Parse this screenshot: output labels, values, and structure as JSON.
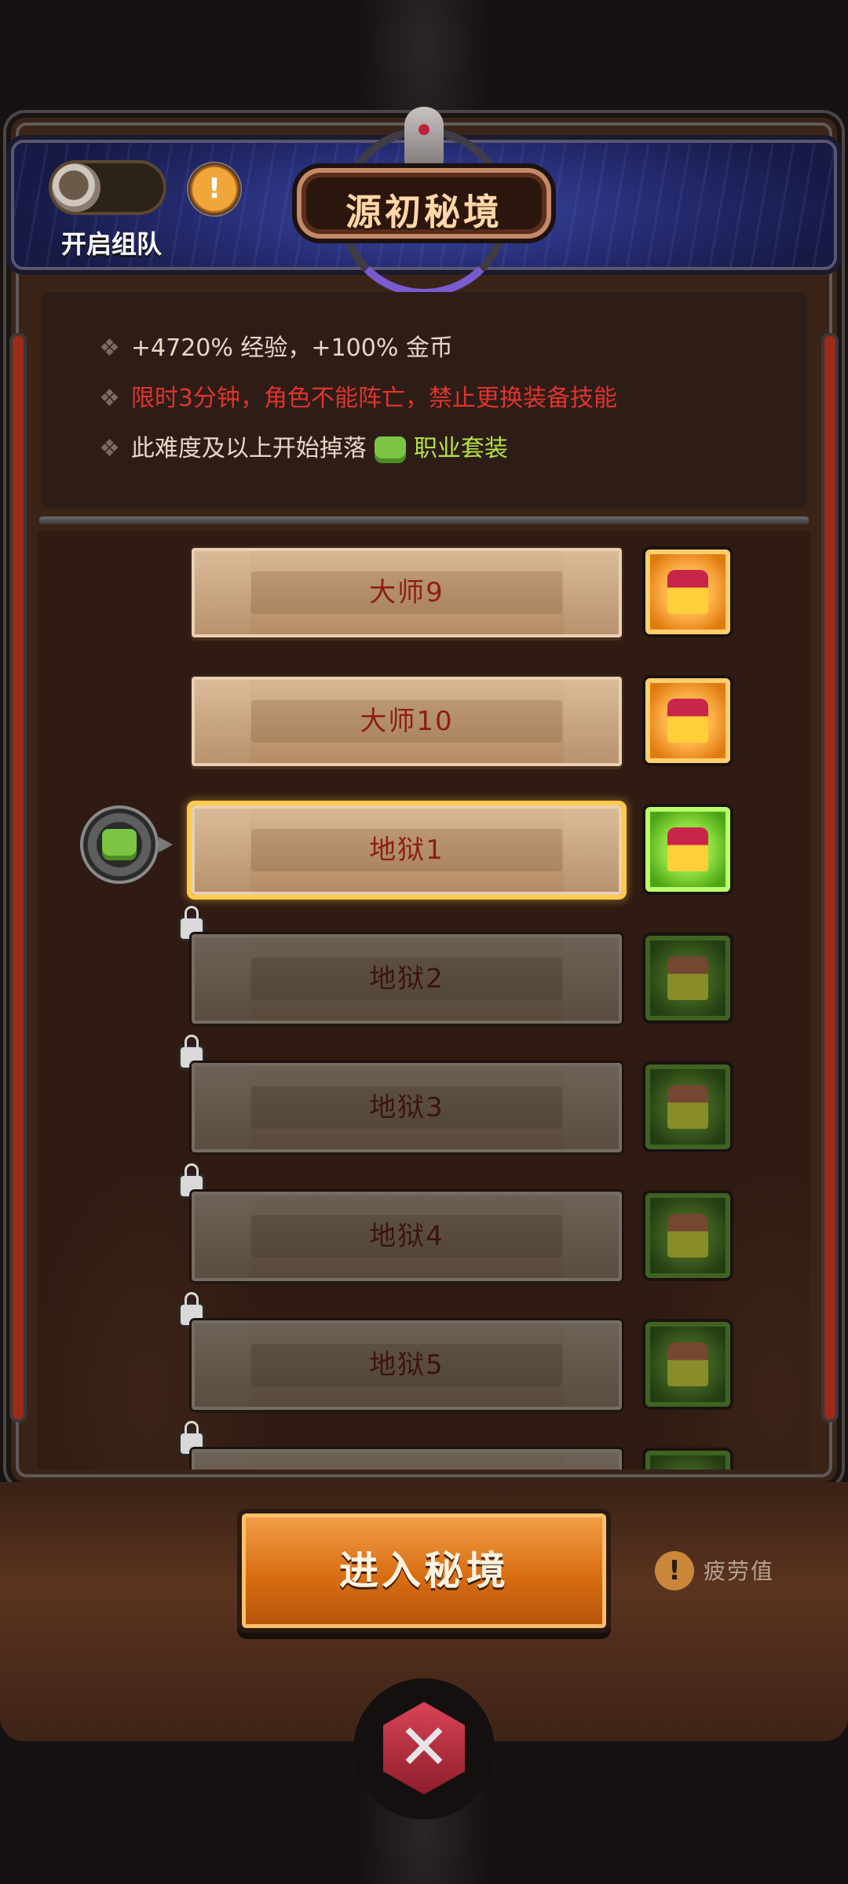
{
  "header": {
    "team_toggle_label": "开启组队",
    "team_toggle_on": false,
    "title": "源初秘境",
    "info_icon": "exclamation-icon"
  },
  "info": {
    "line1": "+4720% 经验，+100% 金币",
    "line2": "限时3分钟，角色不能阵亡，禁止更换装备技能",
    "line3_prefix": "此难度及以上开始掉落",
    "line3_suffix": "职业套装",
    "bullet": "❖"
  },
  "levels": [
    {
      "label": "大师9",
      "state": "unlocked",
      "chest": "orange"
    },
    {
      "label": "大师10",
      "state": "unlocked",
      "chest": "orange"
    },
    {
      "label": "地狱1",
      "state": "selected",
      "chest": "green"
    },
    {
      "label": "地狱2",
      "state": "locked",
      "chest": "green-dim"
    },
    {
      "label": "地狱3",
      "state": "locked",
      "chest": "green-dim"
    },
    {
      "label": "地狱4",
      "state": "locked",
      "chest": "green-dim"
    },
    {
      "label": "地狱5",
      "state": "locked",
      "chest": "green-dim"
    }
  ],
  "footer": {
    "enter_label": "进入秘境",
    "fatigue_label": "疲劳值",
    "fatigue_icon_char": "!"
  },
  "colors": {
    "accent_orange": "#e07b12",
    "set_green": "#7cc444",
    "warning_red": "#e0342e"
  }
}
